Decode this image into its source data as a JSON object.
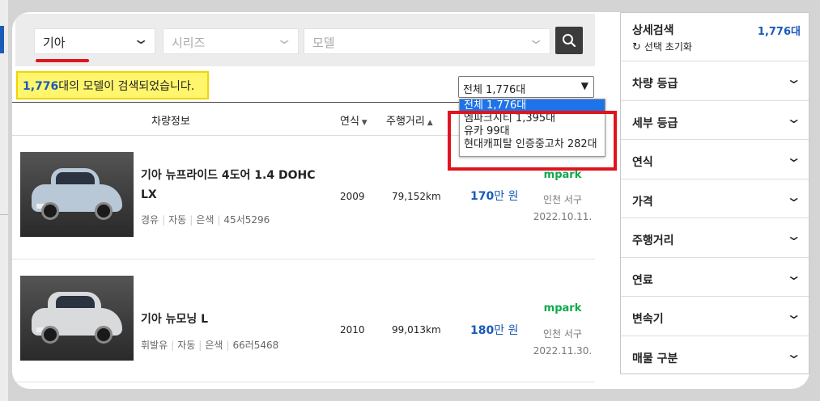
{
  "search": {
    "brand": "기아",
    "series_placeholder": "시리즈",
    "model_placeholder": "모델"
  },
  "result": {
    "count": "1,776",
    "text": "대의 모델이 검색되었습니다."
  },
  "filter": {
    "selected": "전체 1,776대",
    "options": [
      "전체 1,776대",
      "엠파크시티 1,395대",
      "유카 99대",
      "현대캐피탈 인증중고차 282대"
    ]
  },
  "table_headers": {
    "info": "차량정보",
    "year": "연식",
    "mileage": "주행거리"
  },
  "listings": [
    {
      "title": "기아 뉴프라이드 4도어 1.4 DOHC LX",
      "fuel": "경유",
      "transmission": "자동",
      "color": "은색",
      "plate": "45서5296",
      "year": "2009",
      "mileage": "79,152km",
      "price": "170",
      "price_unit": "만 원",
      "dealer": "mpark",
      "location": "인천 서구",
      "date": "2022.10.11.",
      "car_color": "#b9c8d6"
    },
    {
      "title": "기아 뉴모닝 L",
      "fuel": "휘발유",
      "transmission": "자동",
      "color": "은색",
      "plate": "66러5468",
      "year": "2010",
      "mileage": "99,013km",
      "price": "180",
      "price_unit": "만 원",
      "dealer": "mpark",
      "location": "인천 서구",
      "date": "2022.11.30.",
      "car_color": "#d8dadc"
    }
  ],
  "sidebar": {
    "title": "상세검색",
    "count": "1,776대",
    "reset": "선택 초기화",
    "facets": [
      "차량 등급",
      "세부 등급",
      "연식",
      "가격",
      "주행거리",
      "연료",
      "변속기",
      "매물 구분"
    ]
  }
}
